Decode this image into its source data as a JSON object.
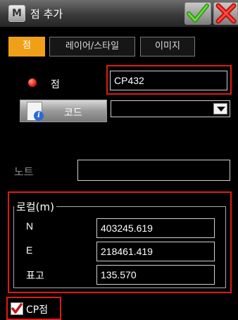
{
  "window": {
    "title": "점 추가"
  },
  "icons": {
    "app": "app-logo-icon",
    "ok": "checkmark-icon",
    "cancel": "close-x-icon",
    "code": "document-info-icon",
    "dropdown": "chevron-down-icon",
    "point": "red-dot-icon"
  },
  "colors": {
    "accent_tab": "#f0a018",
    "highlight": "#e01818",
    "ok": "#3fb020",
    "cancel": "#e02020"
  },
  "app_icon_letter": "M",
  "tabs": [
    {
      "label": "점",
      "active": true
    },
    {
      "label": "레이어/스타일",
      "active": false
    },
    {
      "label": "이미지",
      "active": false
    }
  ],
  "point": {
    "label": "점",
    "value": "CP432"
  },
  "code": {
    "button_label": "코드",
    "value": ""
  },
  "note": {
    "label": "노트",
    "value": ""
  },
  "local": {
    "title": "로컬(m)",
    "fields": [
      {
        "label": "N",
        "value": "403245.619"
      },
      {
        "label": "E",
        "value": "218461.419"
      },
      {
        "label": "표고",
        "value": "135.570"
      }
    ]
  },
  "cp_checkbox": {
    "label": "CP점",
    "checked": true
  }
}
